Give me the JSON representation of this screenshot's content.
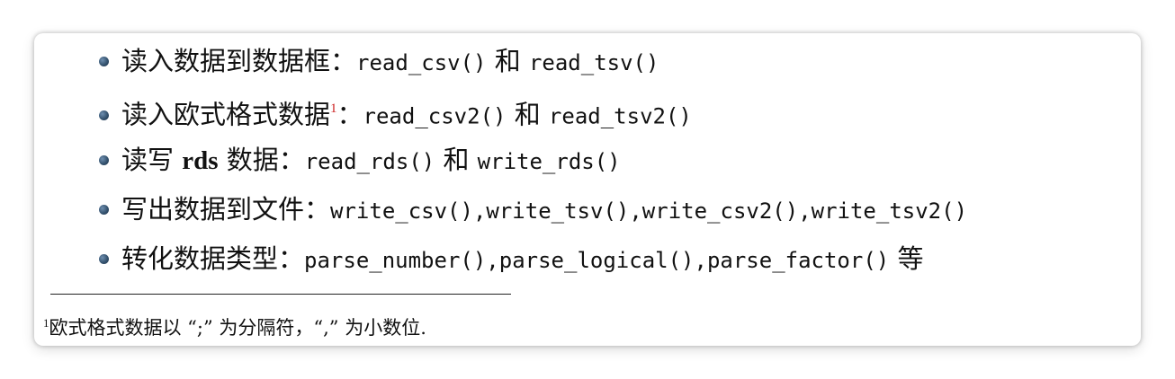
{
  "items": [
    {
      "label": "读入数据到数据框：",
      "code1": "read_csv()",
      "conj": " 和 ",
      "code2": "read_tsv()"
    },
    {
      "label": "读入欧式格式数据",
      "footnote_ref": "1",
      "label_colon": "：",
      "code1": "read_csv2()",
      "conj": " 和 ",
      "code2": "read_tsv2()"
    },
    {
      "label_pre": "读写 ",
      "label_bold": "rds",
      "label_post": " 数据：",
      "code1": "read_rds()",
      "conj": " 和 ",
      "code2": "write_rds()"
    },
    {
      "label": "写出数据到文件：",
      "code": "write_csv(),write_tsv(),write_csv2(),write_tsv2()"
    },
    {
      "label": "转化数据类型：",
      "code": "parse_number(),parse_logical(),parse_factor()",
      "suffix": " 等"
    }
  ],
  "footnote": {
    "mark": "1",
    "text": "欧式格式数据以 “;” 为分隔符，“,” 为小数位."
  },
  "colors": {
    "bullet": "#35536f",
    "footnote_ref": "#cc1f1f",
    "text": "#111111"
  }
}
